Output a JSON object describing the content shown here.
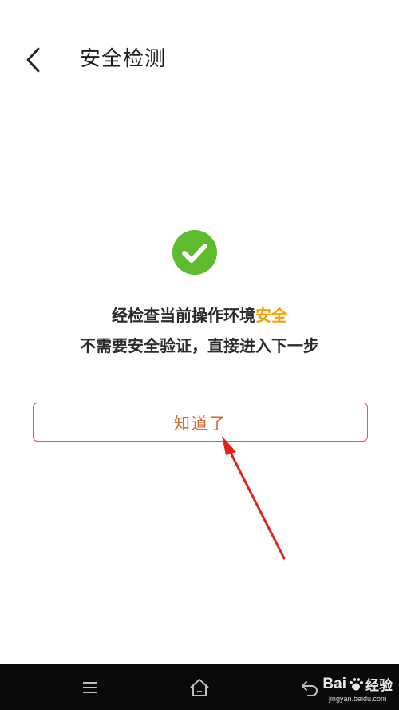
{
  "header": {
    "back_icon": "chevron-left-icon",
    "title": "安全检测"
  },
  "result": {
    "icon": "check-circle-icon",
    "icon_color": "#5dbb2d",
    "line1_prefix": "经检查当前操作环境",
    "line1_highlight": "安全",
    "highlight_color": "#f5a20a",
    "line2": "不需要安全验证，直接进入下一步"
  },
  "actions": {
    "ok_label": "知道了",
    "accent_color": "#d9622a"
  },
  "annotation": {
    "arrow_color": "#e2231a"
  },
  "navbar": {
    "items": [
      "menu-icon",
      "home-icon",
      "back-icon"
    ]
  },
  "watermark": {
    "brand": "Bai",
    "brand_suffix": "经验",
    "url": "jingyan.baidu.com"
  }
}
